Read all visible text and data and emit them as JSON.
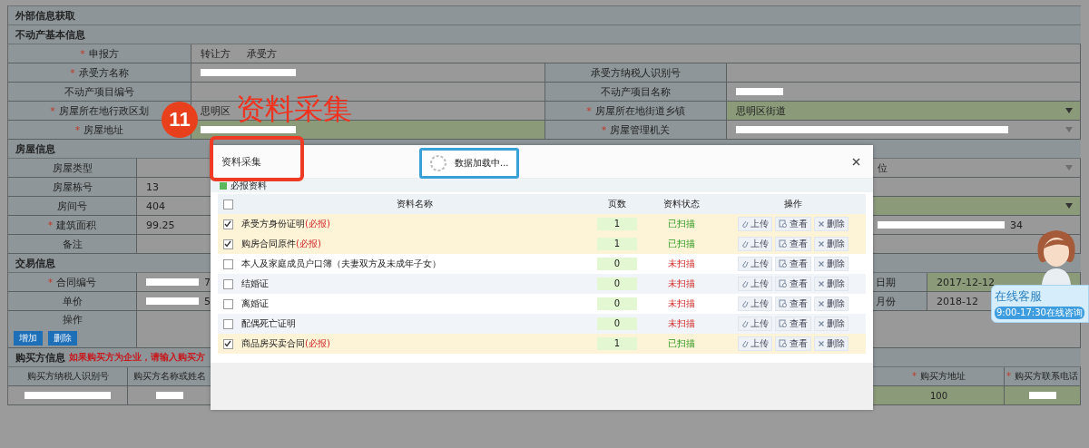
{
  "page_title": "外部信息获取",
  "required_mark": "*",
  "property": {
    "title": "不动产基本信息",
    "rows": [
      {
        "label": "申报方",
        "required": true,
        "value": {
          "kind": "options",
          "options": [
            "转让方",
            "承受方"
          ],
          "highlight": false
        }
      },
      {
        "label": "承受方名称",
        "required": true,
        "value": {
          "kind": "redacted",
          "highlight": false
        },
        "right_label": "承受方纳税人识别号",
        "right_required": false,
        "right_value": {
          "kind": "empty",
          "highlight": false
        }
      },
      {
        "label": "不动产项目编号",
        "required": false,
        "value": {
          "kind": "empty",
          "highlight": false
        },
        "right_label": "不动产项目名称",
        "right_required": false,
        "right_value": {
          "kind": "redacted",
          "highlight": false
        }
      },
      {
        "label": "房屋所在地行政区划",
        "required": true,
        "value": {
          "kind": "text",
          "text": "思明区",
          "highlight": false
        },
        "right_label": "房屋所在地街道乡镇",
        "right_required": true,
        "right_value": {
          "kind": "select",
          "text": "思明区街道",
          "highlight": true
        }
      },
      {
        "label": "房屋地址",
        "required": true,
        "value": {
          "kind": "redacted",
          "highlight": true
        },
        "right_label": "房屋管理机关",
        "right_required": true,
        "right_value": {
          "kind": "select_redacted",
          "highlight": false
        }
      }
    ]
  },
  "house": {
    "title": "房屋信息",
    "rows": [
      {
        "label": "房屋类型",
        "required": false,
        "value": {
          "kind": "empty",
          "highlight": false
        },
        "right": {
          "kind": "select",
          "text": "位",
          "highlight": false
        }
      },
      {
        "label": "房屋栋号",
        "required": false,
        "value": {
          "kind": "text",
          "text": "13",
          "highlight": false
        }
      },
      {
        "label": "房间号",
        "required": false,
        "value": {
          "kind": "text",
          "text": "404",
          "highlight": false
        },
        "right": {
          "kind": "select",
          "highlight": true
        }
      },
      {
        "label": "建筑面积",
        "required": true,
        "value": {
          "kind": "text",
          "text": "99.25",
          "highlight": false
        },
        "right": {
          "kind": "redacted",
          "text": "34",
          "highlight": false
        }
      },
      {
        "label": "备注",
        "required": false,
        "value": {
          "kind": "empty",
          "highlight": false
        }
      }
    ]
  },
  "trade": {
    "title": "交易信息",
    "rows": [
      {
        "label": "合同编号",
        "required": true,
        "value": {
          "kind": "redacted",
          "text": "7",
          "highlight": false
        },
        "right_label": "日期",
        "right": {
          "kind": "text",
          "text": "2017-12-12",
          "highlight": true
        }
      },
      {
        "label": "单价",
        "required": false,
        "value": {
          "kind": "redacted",
          "text": "5",
          "highlight": false
        },
        "right_label": "月份",
        "right": {
          "kind": "text",
          "text": "2018-12",
          "highlight": false
        }
      }
    ]
  },
  "operation": {
    "label": "操作",
    "buttons": [
      "增加",
      "删除"
    ]
  },
  "buyer": {
    "title": "购买方信息",
    "notice": "如果购买方为企业，请输入购买方",
    "columns": [
      {
        "label": "购买方纳税人识别号",
        "required": false
      },
      {
        "label": "购买方名称或姓名",
        "required": false
      },
      {
        "label": "购买方地址",
        "required": true
      },
      {
        "label": "购买方联系电话",
        "required": true
      }
    ],
    "values": [
      {
        "kind": "redacted",
        "highlight": false
      },
      {
        "kind": "redacted",
        "highlight": false
      },
      {
        "kind": "text",
        "text": "100",
        "highlight": true
      },
      {
        "kind": "redacted",
        "highlight": true
      }
    ]
  },
  "annotation": {
    "number": "11",
    "caption": "资料采集"
  },
  "dialog": {
    "title": "资料采集",
    "loading": "数据加载中...",
    "legend": "必报资料",
    "select_all": false,
    "columns": [
      "资料名称",
      "页数",
      "资料状态",
      "操作"
    ],
    "rows": [
      {
        "name": "承受方身份证明",
        "tag": "(必报)",
        "checked": true,
        "pages": "1",
        "status": "已扫描",
        "scanned": true,
        "actions": [
          "上传",
          "查看",
          "删除"
        ]
      },
      {
        "name": "购房合同原件",
        "tag": "(必报)",
        "checked": true,
        "pages": "1",
        "status": "已扫描",
        "scanned": true,
        "actions": [
          "上传",
          "查看",
          "删除"
        ]
      },
      {
        "name": "本人及家庭成员户口簿（夫妻双方及未成年子女）",
        "checked": false,
        "pages": "0",
        "status": "未扫描",
        "scanned": false,
        "actions": [
          "上传",
          "查看",
          "删除"
        ]
      },
      {
        "name": "结婚证",
        "checked": false,
        "pages": "0",
        "status": "未扫描",
        "scanned": false,
        "actions": [
          "上传",
          "查看",
          "删除"
        ]
      },
      {
        "name": "离婚证",
        "checked": false,
        "pages": "0",
        "status": "未扫描",
        "scanned": false,
        "actions": [
          "上传",
          "查看",
          "删除"
        ]
      },
      {
        "name": "配偶死亡证明",
        "checked": false,
        "pages": "0",
        "status": "未扫描",
        "scanned": false,
        "actions": [
          "上传",
          "查看",
          "删除"
        ]
      },
      {
        "name": "商品房买卖合同",
        "tag": "(必报)",
        "checked": true,
        "pages": "1",
        "status": "已扫描",
        "scanned": true,
        "actions": [
          "上传",
          "查看",
          "删除"
        ]
      }
    ]
  },
  "chat_widget": {
    "title": "在线客服",
    "hours": "9:00-17:30在线咨询"
  }
}
